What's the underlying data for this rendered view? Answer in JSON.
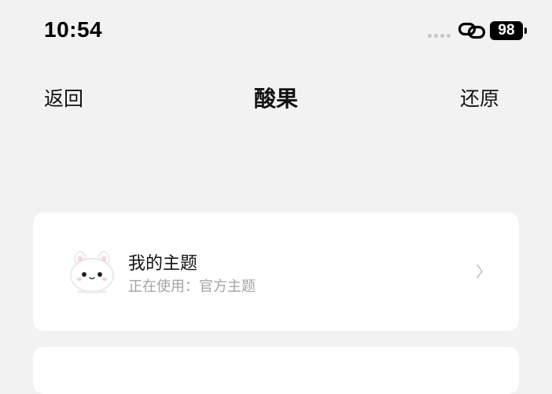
{
  "status_bar": {
    "time": "10:54",
    "battery_level": "98",
    "icons": [
      "signal-dots-icon",
      "link-icon",
      "battery-icon"
    ]
  },
  "nav": {
    "back_label": "返回",
    "title": "酸果",
    "restore_label": "还原"
  },
  "theme_card": {
    "title": "我的主题",
    "status_prefix": "正在使用：",
    "status_value": "官方主题",
    "avatar_icon": "bunny-avatar-icon",
    "chevron_icon": "chevron-right-icon"
  },
  "colors": {
    "background": "#f2f2f2",
    "card": "#ffffff",
    "text_primary": "#111111",
    "text_secondary": "#a4a4a4"
  }
}
